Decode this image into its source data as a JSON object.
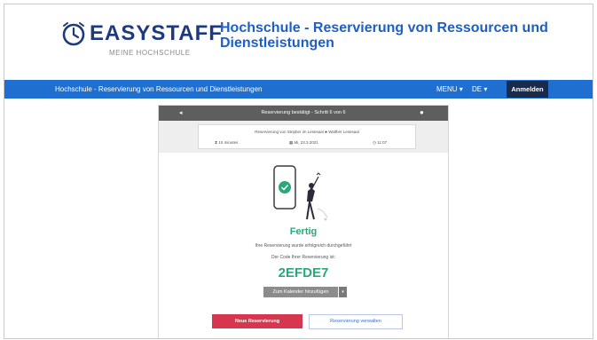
{
  "header": {
    "logo_text": "EASYSTAFF",
    "logo_subtext": "MEINE HOCHSCHULE",
    "site_title": "Hochschule - Reservierung von Ressourcen und Dienstleistungen"
  },
  "navbar": {
    "title": "Hochschule - Reservierung von Ressourcen und Dienstleistungen",
    "menu_label": "MENU ▾",
    "lang_label": "DE ▾",
    "login_label": "Anmelden"
  },
  "card": {
    "header_title": "Reservierung bestätigt - Schritt 6 von 6",
    "summary": {
      "resource": "Reservierung von Stripber im Lesesaal   ♣ Walther Lesesaal",
      "duration": "⧗ 15 minutes",
      "date": "▦ Mi, 23.3.2021",
      "time": "◷ 11:07"
    },
    "status": "Fertig",
    "message": "Ihre Reservierung wurde erfolgreich durchgeführt",
    "code_label": "Der Code Ihrer Reservierung ist:",
    "code": "2EFDE7",
    "calendar_button": "Zum Kalender hinzufügen",
    "calendar_caret": "▾",
    "new_button": "Neue Reservierung",
    "manage_button": "Reservierung verwalten"
  },
  "colors": {
    "brand_blue": "#1e6fd0",
    "logo_navy": "#1e3a7d",
    "success_green": "#2aa87a",
    "primary_red": "#d8364e"
  }
}
